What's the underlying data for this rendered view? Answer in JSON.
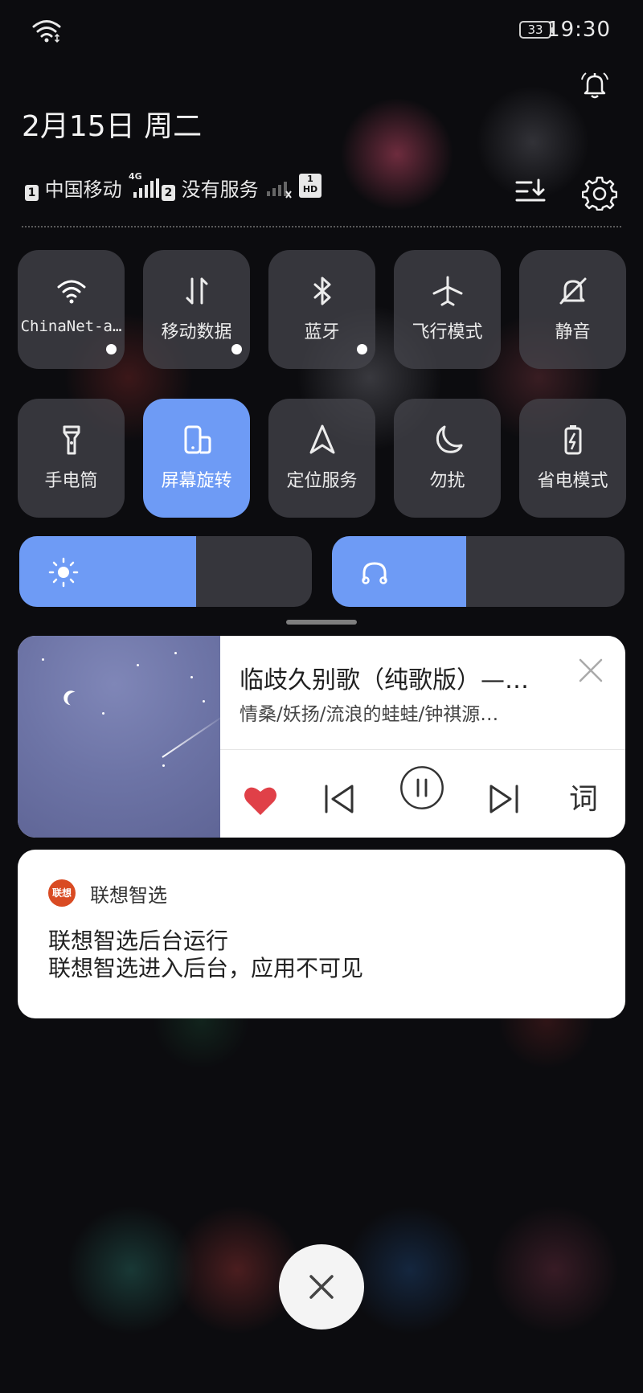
{
  "status_bar": {
    "time": "19:30",
    "battery": "33"
  },
  "header": {
    "date": "2月15日 周二"
  },
  "sims": [
    {
      "slot": "1",
      "name": "中国移动",
      "network": "4G"
    },
    {
      "slot": "2",
      "name": "没有服务"
    }
  ],
  "volte_badge": {
    "top": "1",
    "bottom": "HD"
  },
  "quick_tiles": [
    {
      "label": "ChinaNet-a…",
      "icon": "wifi-icon",
      "active": true,
      "has_dot": true
    },
    {
      "label": "移动数据",
      "icon": "mobile-data-icon",
      "active": false,
      "has_dot": true
    },
    {
      "label": "蓝牙",
      "icon": "bluetooth-icon",
      "active": false,
      "has_dot": true
    },
    {
      "label": "飞行模式",
      "icon": "airplane-icon",
      "active": false,
      "has_dot": false
    },
    {
      "label": "静音",
      "icon": "mute-icon",
      "active": false,
      "has_dot": false
    },
    {
      "label": "手电筒",
      "icon": "flashlight-icon",
      "active": false,
      "has_dot": false
    },
    {
      "label": "屏幕旋转",
      "icon": "rotate-icon",
      "active": true,
      "has_dot": false
    },
    {
      "label": "定位服务",
      "icon": "location-icon",
      "active": false,
      "has_dot": false
    },
    {
      "label": "勿扰",
      "icon": "moon-icon",
      "active": false,
      "has_dot": false
    },
    {
      "label": "省电模式",
      "icon": "battery-saver-icon",
      "active": false,
      "has_dot": false
    }
  ],
  "sliders": {
    "brightness": {
      "level": 0.605,
      "icon": "brightness-icon"
    },
    "volume": {
      "level": 0.46,
      "icon": "headphones-icon"
    }
  },
  "music": {
    "title": "临歧久别歌（纯歌版）—…",
    "artist": "情桑/妖扬/流浪的蛙蛙/钟祺源…",
    "lyrics_label": "词",
    "liked": true
  },
  "notification": {
    "app_icon_text": "联想",
    "app_name": "联想智选",
    "line1": "联想智选后台运行",
    "line2": "联想智选进入后台，应用不可见"
  },
  "colors": {
    "accent": "#6e9bf5",
    "heart": "#e04048",
    "tile": "#46464e"
  }
}
